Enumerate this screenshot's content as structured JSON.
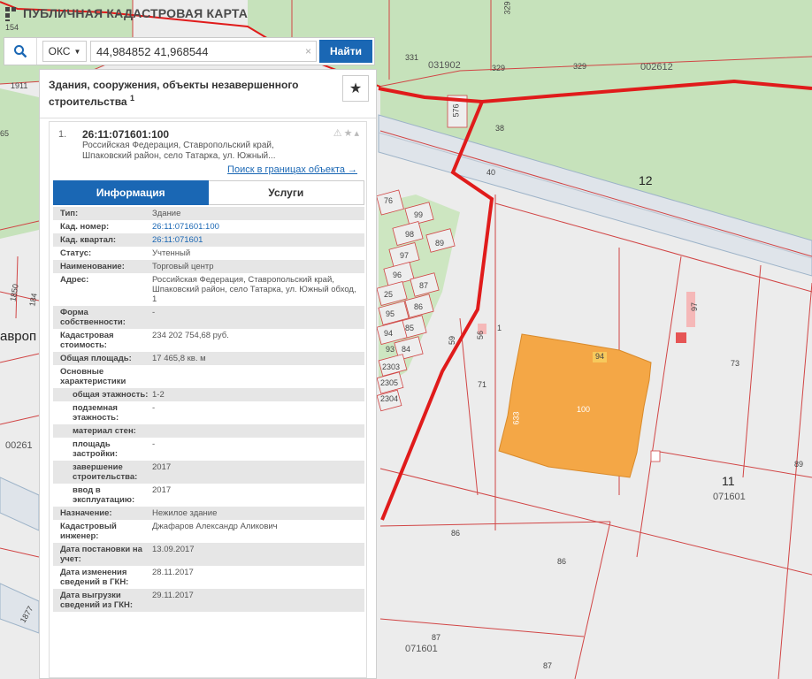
{
  "app": {
    "title": "ПУБЛИЧНАЯ КАДАСТРОВАЯ КАРТА"
  },
  "search": {
    "type_label": "ОКС",
    "query": "44,984852 41,968544",
    "clear_glyph": "×",
    "find_label": "Найти"
  },
  "panel": {
    "title": "Здания, сооружения, объекты незавершенного строительства",
    "title_count": "1",
    "result": {
      "index": "1.",
      "cad_number": "26:11:071601:100",
      "address_short": "Российская Федерация, Ставропольский край, Шпаковский район, село Татарка, ул. Южный...",
      "search_link": "Поиск в границах объекта →"
    },
    "tabs": [
      {
        "label": "Информация",
        "active": true
      },
      {
        "label": "Услуги",
        "active": false
      }
    ],
    "rows": [
      {
        "k": "Тип:",
        "v": "Здание"
      },
      {
        "k": "Кад. номер:",
        "v": "26:11:071601:100",
        "link": true
      },
      {
        "k": "Кад. квартал:",
        "v": "26:11:071601",
        "link": true
      },
      {
        "k": "Статус:",
        "v": "Учтенный"
      },
      {
        "k": "Наименование:",
        "v": "Торговый центр"
      },
      {
        "k": "Адрес:",
        "v": "Российская Федерация, Ставропольский край, Шпаковский район, село Татарка, ул. Южный обход, 1"
      },
      {
        "k": "Форма собственности:",
        "v": "-"
      },
      {
        "k": "Кадастровая стоимость:",
        "v": "234 202 754,68 руб."
      },
      {
        "k": "Общая площадь:",
        "v": "17 465,8 кв. м"
      },
      {
        "k": "Основные характеристики",
        "v": ""
      },
      {
        "k": "общая этажность:",
        "v": "1-2",
        "indent": true
      },
      {
        "k": "подземная этажность:",
        "v": "-",
        "indent": true
      },
      {
        "k": "материал стен:",
        "v": "",
        "indent": true
      },
      {
        "k": "площадь застройки:",
        "v": "-",
        "indent": true
      },
      {
        "k": "завершение строительства:",
        "v": "2017",
        "indent": true
      },
      {
        "k": "ввод в эксплуатацию:",
        "v": "2017",
        "indent": true
      },
      {
        "k": "Назначение:",
        "v": "Нежилое здание"
      },
      {
        "k": "Кадастровый инженер:",
        "v": "Джафаров Александр Аликович"
      },
      {
        "k": "Дата постановки на учет:",
        "v": "13.09.2017"
      },
      {
        "k": "Дата изменения сведений в ГКН:",
        "v": "28.11.2017"
      },
      {
        "k": "Дата выгрузки сведений из ГКН:",
        "v": "29.11.2017"
      }
    ]
  },
  "map_labels": {
    "l154": "154",
    "l1911": "1911",
    "l65": "65",
    "l1850": "1850",
    "l184": "184",
    "lavrop": "аврoп",
    "l00261": "00261",
    "l1877": "1877",
    "l331": "331",
    "l031902": "031902",
    "l329a": "329",
    "l329b": "329",
    "l002612": "002612",
    "l576": "576",
    "l38": "38",
    "l40": "40",
    "l12": "12",
    "l76": "76",
    "l99": "99",
    "l98": "98",
    "l97": "97",
    "l89": "89",
    "l96": "96",
    "l87": "87",
    "l25": "25",
    "l95": "95",
    "l86": "86",
    "l94": "94",
    "l85": "85",
    "l93": "93",
    "l84": "84",
    "l2303": "2303",
    "l2305": "2305",
    "l2304": "2304",
    "l59": "59",
    "l56": "56",
    "l71": "71",
    "l73": "73",
    "l94b": "94",
    "l100": "100",
    "l633": "633",
    "l11": "11",
    "l071601a": "071601",
    "l89b": "89",
    "l86b": "86",
    "l86c": "86",
    "l87b": "87",
    "l071601b": "071601",
    "l87c": "87",
    "l97b": "97",
    "l1": "1",
    "l329top": "329"
  }
}
